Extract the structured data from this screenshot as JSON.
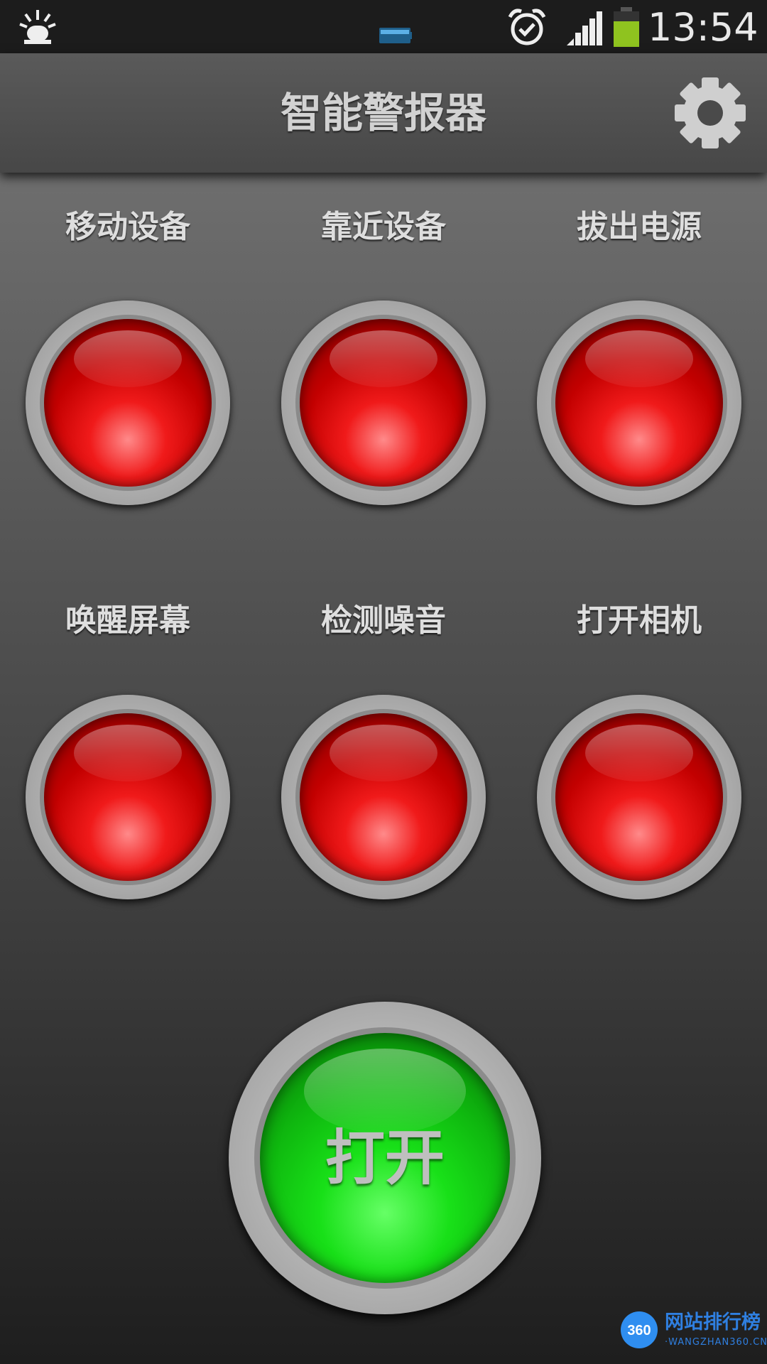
{
  "status_bar": {
    "time": "13:54",
    "icons": [
      "siren-notification-icon",
      "battery-notification-icon",
      "alarm-clock-icon",
      "signal-strength-icon",
      "battery-icon"
    ]
  },
  "app_bar": {
    "title": "智能警报器",
    "settings_icon": "gear-icon"
  },
  "sensors": [
    {
      "label": "移动设备"
    },
    {
      "label": "靠近设备"
    },
    {
      "label": "拔出电源"
    },
    {
      "label": "唤醒屏幕"
    },
    {
      "label": "检测噪音"
    },
    {
      "label": "打开相机"
    }
  ],
  "power_button": {
    "label": "打开"
  },
  "watermark": {
    "text": "网站排行榜",
    "subtext": "·WANGZHAN360.CN·",
    "logo": "360"
  },
  "colors": {
    "sensor_off_red": "#e00000",
    "power_green": "#18e018",
    "app_bar": "#4f4f4f"
  }
}
